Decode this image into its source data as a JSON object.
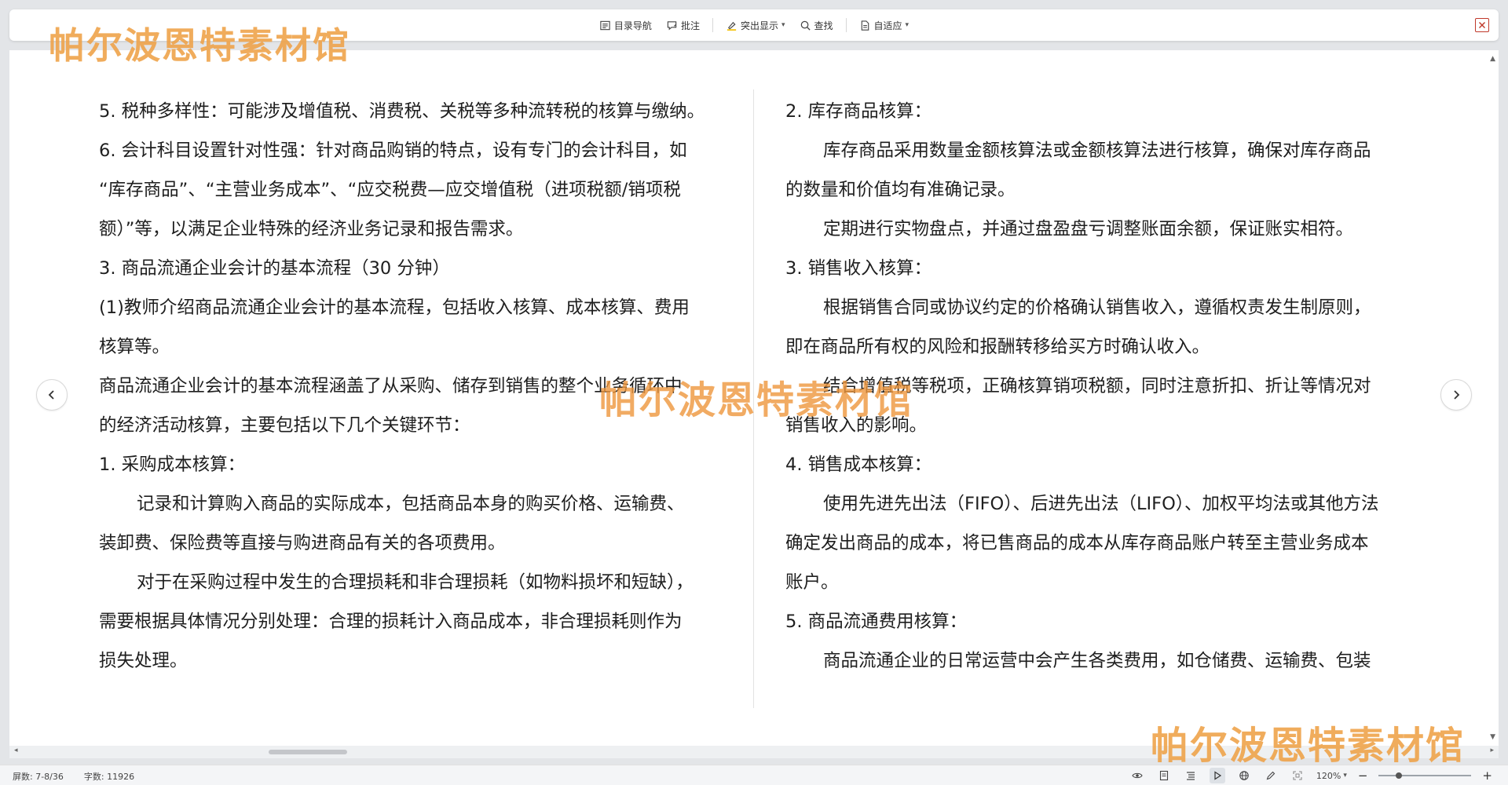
{
  "toolbar": {
    "nav_label": "目录导航",
    "comment_label": "批注",
    "highlight_label": "突出显示",
    "find_label": "查找",
    "fit_label": "自适应"
  },
  "watermark": {
    "text": "帕尔波恩特素材馆"
  },
  "document": {
    "left_column": [
      "5. 税种多样性：可能涉及增值税、消费税、关税等多种流转税的核算与缴纳。",
      "6. 会计科目设置针对性强：针对商品购销的特点，设有专门的会计科目，如",
      "“库存商品”、“主营业务成本”、“应交税费—应交增值税（进项税额/销项税",
      "额）”等，以满足企业特殊的经济业务记录和报告需求。",
      "3. 商品流通企业会计的基本流程（30 分钟）",
      "(1)教师介绍商品流通企业会计的基本流程，包括收入核算、成本核算、费用",
      "核算等。",
      "商品流通企业会计的基本流程涵盖了从采购、储存到销售的整个业务循环中",
      "的经济活动核算，主要包括以下几个关键环节：",
      "1. 采购成本核算：",
      "记录和计算购入商品的实际成本，包括商品本身的购买价格、运输费、",
      "装卸费、保险费等直接与购进商品有关的各项费用。",
      "对于在采购过程中发生的合理损耗和非合理损耗（如物料损坏和短缺），",
      "需要根据具体情况分别处理：合理的损耗计入商品成本，非合理损耗则作为",
      "损失处理。"
    ],
    "right_column": [
      "2. 库存商品核算：",
      "库存商品采用数量金额核算法或金额核算法进行核算，确保对库存商品",
      "的数量和价值均有准确记录。",
      "定期进行实物盘点，并通过盘盈盘亏调整账面余额，保证账实相符。",
      "3. 销售收入核算：",
      "根据销售合同或协议约定的价格确认销售收入，遵循权责发生制原则，",
      "即在商品所有权的风险和报酬转移给买方时确认收入。",
      "结合增值税等税项，正确核算销项税额，同时注意折扣、折让等情况对",
      "销售收入的影响。",
      "4. 销售成本核算：",
      "使用先进先出法（FIFO）、后进先出法（LIFO）、加权平均法或其他方法",
      "确定发出商品的成本，将已售商品的成本从库存商品账户转至主营业务成本",
      "账户。",
      "5. 商品流通费用核算：",
      "商品流通企业的日常运营中会产生各类费用，如仓储费、运输费、包装"
    ]
  },
  "statusbar": {
    "page_info": "屏数: 7-8/36",
    "word_count": "字数: 11926",
    "zoom": "120%",
    "zoom_level": 0.2
  }
}
